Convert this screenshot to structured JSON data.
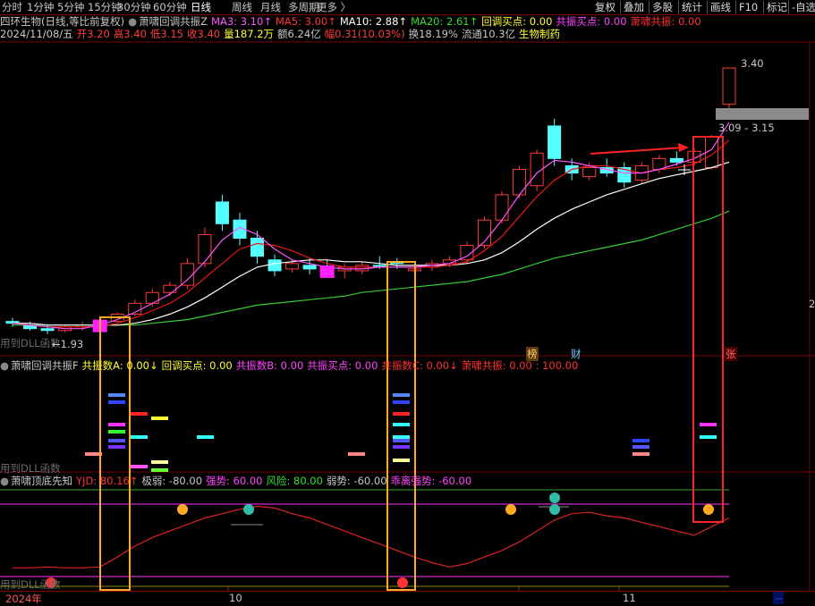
{
  "period_tabs": [
    {
      "label": "分时",
      "active": false
    },
    {
      "label": "1分钟",
      "active": false
    },
    {
      "label": "5分钟",
      "active": false
    },
    {
      "label": "15分钟",
      "active": false
    },
    {
      "label": "30分钟",
      "active": false
    },
    {
      "label": "60分钟",
      "active": false
    },
    {
      "label": "日线",
      "active": true
    },
    {
      "label": "周线",
      "active": false
    },
    {
      "label": "月线",
      "active": false
    },
    {
      "label": "多周期",
      "active": false
    },
    {
      "label": "更多",
      "active": false
    }
  ],
  "toolbar": [
    "复权",
    "叠加",
    "多股",
    "统计",
    "画线",
    "F10",
    "标记",
    "-自选"
  ],
  "header": {
    "stock": "四环生物(日线,等比前复权)",
    "indicator_name": "萧啸回调共振Z",
    "ma3": "MA3: 3.10↑",
    "ma5": "MA5: 3.00↑",
    "ma10": "MA10: 2.88↑",
    "ma20": "MA20: 2.61↑",
    "pullback_buy": "回调买点: 0.00",
    "resonance_buy": "共振买点: 0.00",
    "resonance": "萧啸共振: 0.00"
  },
  "quote": {
    "date": "2024/11/08/五",
    "open": "开3.20",
    "high": "高3.40",
    "low": "低3.15",
    "close": "收3.40",
    "volume": "量187.2万",
    "amount": "额6.24亿",
    "change": "幅0.31(10.03%)",
    "turnover": "换18.19%",
    "float": "流通10.3亿",
    "sector": "生物制药"
  },
  "price_labels": {
    "high": "3.40",
    "low": "1.93",
    "range": "3.09 - 3.15",
    "right_edge": "2"
  },
  "markers": {
    "bang": "榜",
    "cai": "财",
    "zhang": "张"
  },
  "dll_note": "用到DLL函数",
  "panel2": {
    "name": "萧啸回调共振F",
    "a": "共振数A: 0.00↓",
    "pullback": "回调买点: 0.00",
    "b": "共振数B: 0.00",
    "resbuy": "共振买点: 0.00",
    "c": "共振数C: 0.00↓",
    "resonance": "萧啸共振: 0.00 : 100.00"
  },
  "panel3": {
    "name": "萧啸顶底先知",
    "yjd": "YJD: 80.16↑",
    "weak_extreme": "极弱: -80.00",
    "strong": "强势: 60.00",
    "risk": "风险: 80.00",
    "weak": "弱势: -60.00",
    "extreme_strong": "乖离强势: -60.00"
  },
  "time_axis": {
    "year": "2024年",
    "oct": "10",
    "nov": "11",
    "end": "--"
  },
  "colors": {
    "up": "#ff3c3c",
    "down": "#54ffff",
    "ma3": "#ff55ff",
    "ma5": "#e81818",
    "ma10": "#ffffff",
    "ma20": "#33cc33",
    "highlight_orange": "#ffaa22",
    "highlight_red": "#ff2222",
    "grid": "#7a0000"
  },
  "chart_data": {
    "type": "candlestick",
    "title": "四环生物(日线,等比前复权)",
    "ylim": [
      1.85,
      3.45
    ],
    "candles": [
      {
        "o": 2.0,
        "h": 2.02,
        "l": 1.97,
        "c": 1.99
      },
      {
        "o": 1.98,
        "h": 2.0,
        "l": 1.95,
        "c": 1.96
      },
      {
        "o": 1.96,
        "h": 1.98,
        "l": 1.93,
        "c": 1.95
      },
      {
        "o": 1.95,
        "h": 1.98,
        "l": 1.94,
        "c": 1.97
      },
      {
        "o": 1.97,
        "h": 2.0,
        "l": 1.95,
        "c": 1.98
      },
      {
        "o": 1.98,
        "h": 2.02,
        "l": 1.96,
        "c": 2.0
      },
      {
        "o": 2.0,
        "h": 2.05,
        "l": 1.99,
        "c": 2.04
      },
      {
        "o": 2.04,
        "h": 2.12,
        "l": 2.03,
        "c": 2.1
      },
      {
        "o": 2.1,
        "h": 2.18,
        "l": 2.08,
        "c": 2.16
      },
      {
        "o": 2.16,
        "h": 2.22,
        "l": 2.14,
        "c": 2.2
      },
      {
        "o": 2.2,
        "h": 2.35,
        "l": 2.18,
        "c": 2.32
      },
      {
        "o": 2.32,
        "h": 2.52,
        "l": 2.3,
        "c": 2.48
      },
      {
        "o": 2.66,
        "h": 2.7,
        "l": 2.5,
        "c": 2.54
      },
      {
        "o": 2.56,
        "h": 2.6,
        "l": 2.42,
        "c": 2.46
      },
      {
        "o": 2.46,
        "h": 2.5,
        "l": 2.32,
        "c": 2.36
      },
      {
        "o": 2.34,
        "h": 2.37,
        "l": 2.25,
        "c": 2.28
      },
      {
        "o": 2.29,
        "h": 2.34,
        "l": 2.27,
        "c": 2.32
      },
      {
        "o": 2.31,
        "h": 2.35,
        "l": 2.26,
        "c": 2.29
      },
      {
        "o": 2.3,
        "h": 2.34,
        "l": 2.26,
        "c": 2.28
      },
      {
        "o": 2.28,
        "h": 2.32,
        "l": 2.24,
        "c": 2.3
      },
      {
        "o": 2.28,
        "h": 2.33,
        "l": 2.26,
        "c": 2.31
      },
      {
        "o": 2.31,
        "h": 2.36,
        "l": 2.29,
        "c": 2.3
      },
      {
        "o": 2.33,
        "h": 2.35,
        "l": 2.29,
        "c": 2.32
      },
      {
        "o": 2.28,
        "h": 2.31,
        "l": 2.26,
        "c": 2.29
      },
      {
        "o": 2.3,
        "h": 2.34,
        "l": 2.28,
        "c": 2.32
      },
      {
        "o": 2.32,
        "h": 2.36,
        "l": 2.3,
        "c": 2.34
      },
      {
        "o": 2.34,
        "h": 2.44,
        "l": 2.32,
        "c": 2.42
      },
      {
        "o": 2.42,
        "h": 2.58,
        "l": 2.4,
        "c": 2.56
      },
      {
        "o": 2.56,
        "h": 2.72,
        "l": 2.54,
        "c": 2.7
      },
      {
        "o": 2.7,
        "h": 2.86,
        "l": 2.68,
        "c": 2.84
      },
      {
        "o": 2.75,
        "h": 2.95,
        "l": 2.72,
        "c": 2.93
      },
      {
        "o": 3.08,
        "h": 3.12,
        "l": 2.86,
        "c": 2.9
      },
      {
        "o": 2.86,
        "h": 2.9,
        "l": 2.78,
        "c": 2.82
      },
      {
        "o": 2.8,
        "h": 2.88,
        "l": 2.78,
        "c": 2.85
      },
      {
        "o": 2.85,
        "h": 2.9,
        "l": 2.8,
        "c": 2.82
      },
      {
        "o": 2.85,
        "h": 2.88,
        "l": 2.74,
        "c": 2.77
      },
      {
        "o": 2.78,
        "h": 2.88,
        "l": 2.76,
        "c": 2.86
      },
      {
        "o": 2.84,
        "h": 2.92,
        "l": 2.82,
        "c": 2.9
      },
      {
        "o": 2.9,
        "h": 2.94,
        "l": 2.86,
        "c": 2.88
      },
      {
        "o": 2.88,
        "h": 2.96,
        "l": 2.86,
        "c": 2.94
      },
      {
        "o": 2.85,
        "h": 3.03,
        "l": 2.84,
        "c": 3.02
      },
      {
        "o": 3.2,
        "h": 3.4,
        "l": 3.15,
        "c": 3.4
      }
    ],
    "ma3": [
      1.99,
      1.98,
      1.97,
      1.96,
      1.96,
      1.98,
      2.01,
      2.05,
      2.1,
      2.15,
      2.23,
      2.33,
      2.45,
      2.52,
      2.48,
      2.4,
      2.34,
      2.32,
      2.3,
      2.29,
      2.29,
      2.3,
      2.3,
      2.3,
      2.31,
      2.32,
      2.36,
      2.44,
      2.56,
      2.7,
      2.82,
      2.89,
      2.88,
      2.86,
      2.84,
      2.82,
      2.82,
      2.84,
      2.87,
      2.9,
      2.95,
      3.1
    ],
    "ma5": [
      1.99,
      1.98,
      1.97,
      1.97,
      1.97,
      1.97,
      1.99,
      2.02,
      2.06,
      2.1,
      2.16,
      2.24,
      2.32,
      2.4,
      2.43,
      2.42,
      2.39,
      2.35,
      2.32,
      2.3,
      2.3,
      2.3,
      2.3,
      2.3,
      2.3,
      2.31,
      2.33,
      2.39,
      2.47,
      2.58,
      2.69,
      2.78,
      2.84,
      2.86,
      2.86,
      2.84,
      2.82,
      2.84,
      2.85,
      2.87,
      2.92,
      3.0
    ],
    "ma10": [
      1.99,
      1.99,
      1.98,
      1.98,
      1.98,
      1.98,
      1.98,
      1.99,
      2.01,
      2.04,
      2.08,
      2.13,
      2.19,
      2.25,
      2.3,
      2.32,
      2.33,
      2.34,
      2.34,
      2.33,
      2.33,
      2.32,
      2.31,
      2.31,
      2.31,
      2.31,
      2.32,
      2.34,
      2.38,
      2.44,
      2.51,
      2.57,
      2.62,
      2.66,
      2.7,
      2.73,
      2.76,
      2.79,
      2.81,
      2.83,
      2.85,
      2.88
    ],
    "ma20": [
      1.98,
      1.98,
      1.98,
      1.98,
      1.98,
      1.98,
      1.98,
      1.98,
      1.99,
      2.0,
      2.01,
      2.03,
      2.05,
      2.07,
      2.09,
      2.1,
      2.11,
      2.12,
      2.13,
      2.14,
      2.16,
      2.17,
      2.18,
      2.19,
      2.2,
      2.21,
      2.22,
      2.24,
      2.26,
      2.29,
      2.32,
      2.35,
      2.37,
      2.39,
      2.41,
      2.43,
      2.45,
      2.48,
      2.51,
      2.54,
      2.57,
      2.61
    ],
    "oscillator": {
      "name": "YJD",
      "ylim": [
        -100,
        100
      ],
      "values": [
        -80,
        -80,
        -78,
        -80,
        -80,
        -78,
        -55,
        -30,
        -10,
        5,
        20,
        35,
        45,
        55,
        62,
        58,
        45,
        35,
        20,
        5,
        -10,
        -25,
        -40,
        -55,
        -68,
        -78,
        -70,
        -55,
        -40,
        -20,
        5,
        30,
        45,
        48,
        40,
        35,
        25,
        15,
        5,
        -5,
        15,
        35
      ]
    }
  }
}
